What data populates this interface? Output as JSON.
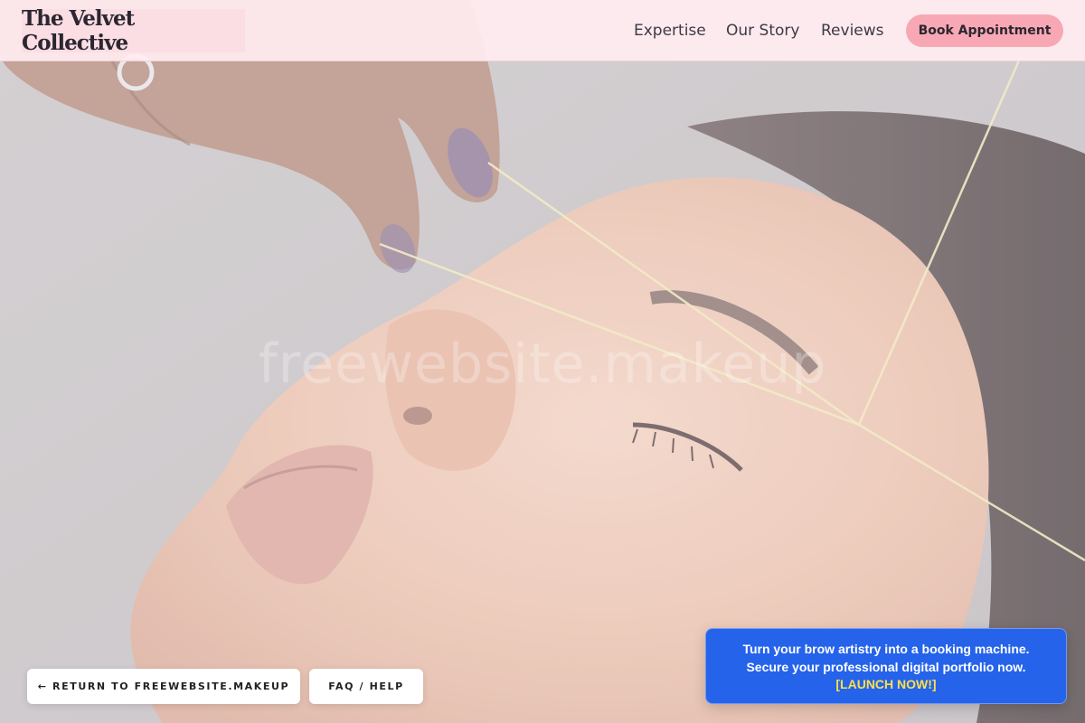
{
  "header": {
    "logo_text": "The Velvet Collective",
    "nav": [
      {
        "label": "Expertise"
      },
      {
        "label": "Our Story"
      },
      {
        "label": "Reviews"
      }
    ],
    "cta_label": "Book Appointment"
  },
  "hero": {
    "watermark": "freewebsite.makeup",
    "image_subject": "eyebrow threading close-up"
  },
  "footer_buttons": {
    "return_label": "← RETURN TO FREEWEBSITE.MAKEUP",
    "faq_label": "FAQ / HELP"
  },
  "promo": {
    "line1": "Turn your brow artistry into a booking machine.",
    "line2": "Secure your professional digital portfolio now.",
    "cta": "[LAUNCH NOW!]"
  },
  "colors": {
    "header_bg": "#ffecf0",
    "logo_bg": "#fbdde4",
    "cta_bg": "#f8a8b5",
    "promo_bg": "#2563eb",
    "promo_cta": "#fde047"
  }
}
